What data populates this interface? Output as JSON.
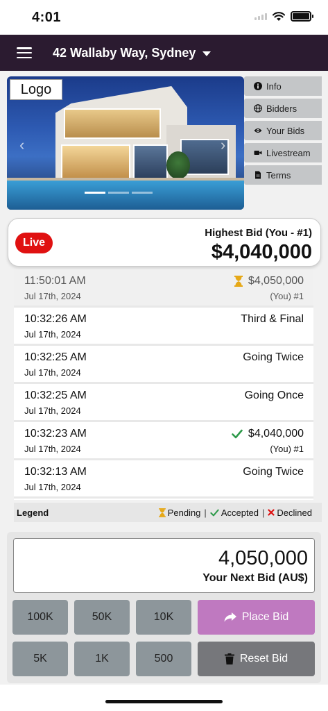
{
  "status_bar": {
    "time": "4:01"
  },
  "header": {
    "title": "42 Wallaby Way, Sydney"
  },
  "hero": {
    "logo_text": "Logo"
  },
  "side_tabs": [
    {
      "label": "Info",
      "icon": "info-icon"
    },
    {
      "label": "Bidders",
      "icon": "globe-icon"
    },
    {
      "label": "Your Bids",
      "icon": "eye-icon"
    },
    {
      "label": "Livestream",
      "icon": "video-icon"
    },
    {
      "label": "Terms",
      "icon": "document-icon"
    }
  ],
  "highest_bid": {
    "badge": "Live",
    "label": "Highest Bid (You - #1)",
    "amount": "$4,040,000"
  },
  "history": [
    {
      "time": "11:50:01 AM",
      "date": "Jul 17th, 2024",
      "status": "$4,050,000",
      "sub": "(You) #1",
      "icon": "hourglass-icon",
      "state": "pending"
    },
    {
      "time": "10:32:26 AM",
      "date": "Jul 17th, 2024",
      "status": "Third & Final",
      "sub": "",
      "icon": "",
      "state": "call"
    },
    {
      "time": "10:32:25 AM",
      "date": "Jul 17th, 2024",
      "status": "Going Twice",
      "sub": "",
      "icon": "",
      "state": "call"
    },
    {
      "time": "10:32:25 AM",
      "date": "Jul 17th, 2024",
      "status": "Going Once",
      "sub": "",
      "icon": "",
      "state": "call"
    },
    {
      "time": "10:32:23 AM",
      "date": "Jul 17th, 2024",
      "status": "$4,040,000",
      "sub": "(You) #1",
      "icon": "check-icon",
      "state": "accepted"
    },
    {
      "time": "10:32:13 AM",
      "date": "Jul 17th, 2024",
      "status": "Going Twice",
      "sub": "",
      "icon": "",
      "state": "call"
    }
  ],
  "legend": {
    "title": "Legend",
    "pending": "Pending",
    "accepted": "Accepted",
    "declined": "Declined",
    "separator": "|"
  },
  "bid_panel": {
    "value": "4,050,000",
    "label": "Your Next Bid (AU$)",
    "increments": [
      "100K",
      "50K",
      "10K",
      "5K",
      "1K",
      "500"
    ],
    "place_label": "Place Bid",
    "reset_label": "Reset Bid"
  },
  "colors": {
    "header_bg": "#2b1b30",
    "live_red": "#e01111",
    "place_bid": "#bf79c0",
    "reset_bid": "#76777b",
    "accepted_green": "#2e9a4a",
    "pending_gold": "#e6a817",
    "declined_red": "#d11"
  }
}
